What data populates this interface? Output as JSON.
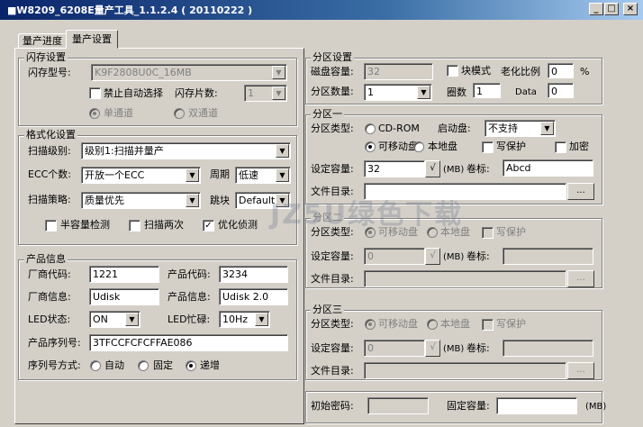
{
  "window": {
    "title": "■W8209_6208E量产工具_1.1.2.4 ( 20110222 )",
    "min": "_",
    "max": "□",
    "close": "×"
  },
  "tabs": [
    "量产进度",
    "量产设置"
  ],
  "flash": {
    "title": "闪存设置",
    "type_label": "闪存型号:",
    "type_value": "K9F2808U0C_16MB",
    "disable_auto": "禁止自动选择",
    "chips_label": "闪存片数:",
    "chips_value": "1",
    "single": "单通道",
    "dual": "双通道"
  },
  "format": {
    "title": "格式化设置",
    "scan_level_label": "扫描级别:",
    "scan_level_value": "级别1:扫描并量产",
    "ecc_label": "ECC个数:",
    "ecc_value": "开放一个ECC",
    "period_label": "周期",
    "period_value": "低速",
    "strategy_label": "扫描策略:",
    "strategy_value": "质量优先",
    "block_label": "跳块",
    "block_value": "Default",
    "half": "半容量检测",
    "twice": "扫描两次",
    "optimize": "优化侦测"
  },
  "product": {
    "title": "产品信息",
    "vid_label": "厂商代码:",
    "vid": "1221",
    "pid_label": "产品代码:",
    "pid": "3234",
    "vendor_label": "厂商信息:",
    "vendor": "Udisk",
    "prod_label": "产品信息:",
    "prod": "Udisk 2.0",
    "led_label": "LED状态:",
    "led": "ON",
    "ledbusy_label": "LED忙碌:",
    "ledbusy": "10Hz",
    "serial_label": "产品序列号:",
    "serial": "3TFCCFCFCFFAE086",
    "serial_mode_label": "序列号方式:",
    "auto": "自动",
    "fixed": "固定",
    "inc": "递增"
  },
  "partition": {
    "title": "分区设置",
    "disk_label": "磁盘容量:",
    "disk": "32",
    "block_mode": "块模式",
    "ratio_label": "老化比例",
    "ratio": "0",
    "pct": "%",
    "count_label": "分区数量:",
    "count": "1",
    "laps_label": "圈数",
    "laps": "1",
    "data_label": "Data",
    "data": "0"
  },
  "p1": {
    "title": "分区一",
    "type_label": "分区类型:",
    "cdrom": "CD-ROM",
    "boot_label": "启动盘:",
    "boot": "不支持",
    "removable": "可移动盘",
    "local": "本地盘",
    "wp": "写保护",
    "encrypt": "加密",
    "cap_label": "设定容量:",
    "cap": "32",
    "check": "√",
    "mb": "(MB)",
    "vol_label": "卷标:",
    "vol": "Abcd",
    "dir_label": "文件目录:",
    "browse": "..."
  },
  "p2": {
    "title": "分区二",
    "type_label": "分区类型:",
    "removable": "可移动盘",
    "local": "本地盘",
    "wp": "写保护",
    "cap_label": "设定容量:",
    "cap": "0",
    "check": "√",
    "mb": "(MB)",
    "vol_label": "卷标:",
    "dir_label": "文件目录:",
    "browse": "..."
  },
  "p3": {
    "title": "分区三",
    "type_label": "分区类型:",
    "removable": "可移动盘",
    "local": "本地盘",
    "wp": "写保护",
    "cap_label": "设定容量:",
    "cap": "0",
    "check": "√",
    "mb": "(MB)",
    "vol_label": "卷标:",
    "dir_label": "文件目录:",
    "browse": "..."
  },
  "bottom": {
    "pwd_label": "初始密码:",
    "fixcap_label": "固定容量:",
    "mb": "(MB)"
  },
  "watermark": "JZ5U绿色下载"
}
